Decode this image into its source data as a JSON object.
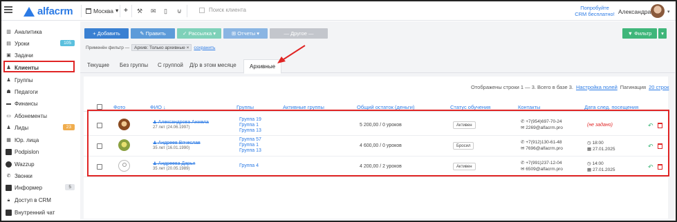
{
  "brand": {
    "logo_text": "alfacrm",
    "accent": "#2c7be5",
    "highlight": "#e02424"
  },
  "header": {
    "branch": "Москва",
    "search_placeholder": "Поиск клиента",
    "promo": "Попробуйте CRM бесплатно!",
    "user_name": "Александра",
    "icons": [
      "plus-icon",
      "wrench-icon",
      "mail-icon",
      "phone-icon",
      "cart-icon"
    ]
  },
  "sidebar": {
    "items": [
      {
        "label": "Аналитика",
        "icon": "chart-icon"
      },
      {
        "label": "Уроки",
        "icon": "lessons-icon",
        "badge": "105"
      },
      {
        "label": "Задачи",
        "icon": "tasks-icon"
      },
      {
        "label": "Клиенты",
        "icon": "user-icon"
      },
      {
        "label": "Группы",
        "icon": "group-icon"
      },
      {
        "label": "Педагоги",
        "icon": "teacher-icon"
      },
      {
        "label": "Финансы",
        "icon": "money-icon"
      },
      {
        "label": "Абонементы",
        "icon": "subscription-icon"
      },
      {
        "label": "Лиды",
        "icon": "leads-icon",
        "badge": "23"
      },
      {
        "label": "Юр. лица",
        "icon": "company-icon"
      },
      {
        "label": "Podpislon",
        "icon": "podpislon-icon"
      },
      {
        "label": "Wazzup",
        "icon": "wazzup-icon"
      },
      {
        "label": "Звонки",
        "icon": "call-icon"
      },
      {
        "label": "Информер",
        "icon": "informer-icon",
        "badge": "5"
      },
      {
        "label": "Доступ в CRM",
        "icon": "lock-icon"
      },
      {
        "label": "Внутренний чат",
        "icon": "chat-icon"
      }
    ]
  },
  "toolbar": {
    "add": "+ Добавить",
    "edit": "✎ Править",
    "mailing": "✓ Рассылка ▾",
    "reports": "⊞ Отчеты ▾",
    "other": "— Другое —",
    "filter": "▼ Фильтр",
    "filter_dd": "▾"
  },
  "filter_line": {
    "prefix": "Применён фильтр —",
    "chip": "Архив: Только архивные",
    "chip_close": "×",
    "save": "сохранить"
  },
  "tabs": [
    "Текущие",
    "Без группы",
    "С группой",
    "Д/р в этом месяце",
    "Архивные"
  ],
  "active_tab": "Архивные",
  "pager": {
    "summary": "Отображены строки 1 — 3. Всего в базе 3.",
    "settings": "Настройка полей",
    "pagination_label": "Пагинация",
    "pagination_value": "20 строк"
  },
  "table": {
    "columns": {
      "photo": "Фото",
      "fio": "ФИО ↓",
      "groups": "Группы",
      "active_groups": "Активные группы",
      "balance": "Общий остаток (деньги)",
      "status": "Статус обучения",
      "contacts": "Контакты",
      "next_visit": "Дата след. посещения"
    },
    "rows": [
      {
        "name": "Александрова Анжела",
        "age": "27 лет (24.06.1997)",
        "groups": [
          "Группа 19",
          "Группа 1",
          "Группа 13"
        ],
        "balance": "5 200,00 / 0 уроков",
        "status": "Активен",
        "phone": "+7(954)697-70-24",
        "email": "2269@alfacrm.pro",
        "next_visit": "(не задано)"
      },
      {
        "name": "Андреев Вячеслав",
        "age": "35 лет (16.01.1990)",
        "groups": [
          "Группа 57",
          "Группа 1",
          "Группа 13"
        ],
        "balance": "4 600,00 / 0 уроков",
        "status": "Бросил",
        "phone": "+7(912)130-61-48",
        "email": "7696@alfacrm.pro",
        "next_time": "18:00",
        "next_date": "27.01.2025"
      },
      {
        "name": "Андреева Дарья",
        "age": "35 лет (20.05.1989)",
        "groups": [
          "Группа 4"
        ],
        "balance": "4 200,00 / 2 уроков",
        "status": "Активен",
        "phone": "+7(991)237-12-04",
        "email": "6509@alfacrm.pro",
        "next_time": "14:00",
        "next_date": "27.01.2025"
      }
    ]
  }
}
